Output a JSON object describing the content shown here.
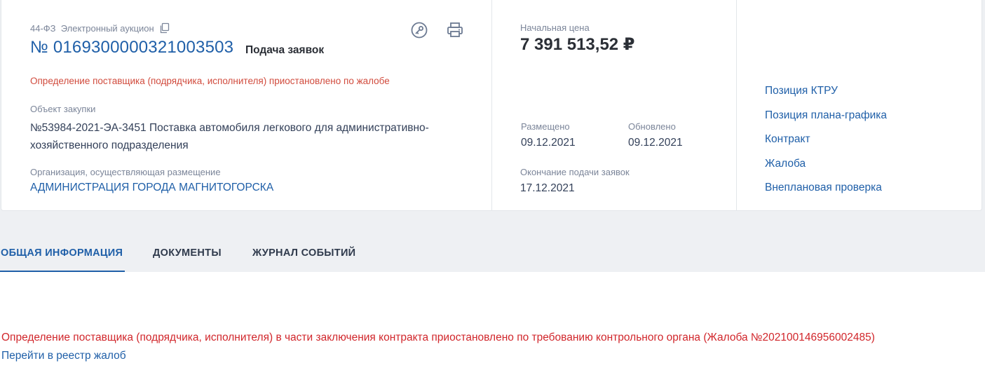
{
  "header": {
    "law_and_method": "44-ФЗ  Электронный аукцион",
    "number": "№ 0169300000321003503",
    "stage": "Подача заявок",
    "suspend_note": "Определение поставщика (подрядчика, исполнителя) приостановлено по жалобе",
    "object_label": "Объект закупки",
    "object_text": "№53984-2021-ЭА-3451 Поставка автомобиля легкового для административно-хозяйственного подразделения",
    "org_label": "Организация, осуществляющая размещение",
    "org_name": "АДМИНИСТРАЦИЯ ГОРОДА МАГНИТОГОРСКА",
    "icons": [
      "copy-icon",
      "key-icon",
      "print-icon"
    ]
  },
  "price": {
    "label": "Начальная цена",
    "value": "7 391 513,52 ₽"
  },
  "dates": {
    "placed_label": "Размещено",
    "placed_value": "09.12.2021",
    "updated_label": "Обновлено",
    "updated_value": "09.12.2021",
    "deadline_label": "Окончание подачи заявок",
    "deadline_value": "17.12.2021"
  },
  "side_links": [
    "Позиция КТРУ",
    "Позиция плана-графика",
    "Контракт",
    "Жалоба",
    "Внеплановая проверка"
  ],
  "tabs": [
    {
      "label": "ОБЩАЯ ИНФОРМАЦИЯ",
      "active": true
    },
    {
      "label": "ДОКУМЕНТЫ",
      "active": false
    },
    {
      "label": "ЖУРНАЛ СОБЫТИЙ",
      "active": false
    }
  ],
  "body": {
    "complaint_text": "Определение поставщика (подрядчика, исполнителя) в части заключения контракта приостановлено по требованию контрольного органа (Жалоба №202100146956002485)",
    "registry_link": "Перейти в реестр жалоб"
  },
  "colors": {
    "accent": "#1f5fa8",
    "warning_text": "#d14b3d",
    "complaint_text": "#d1262b",
    "band_background": "#eef0f3"
  }
}
